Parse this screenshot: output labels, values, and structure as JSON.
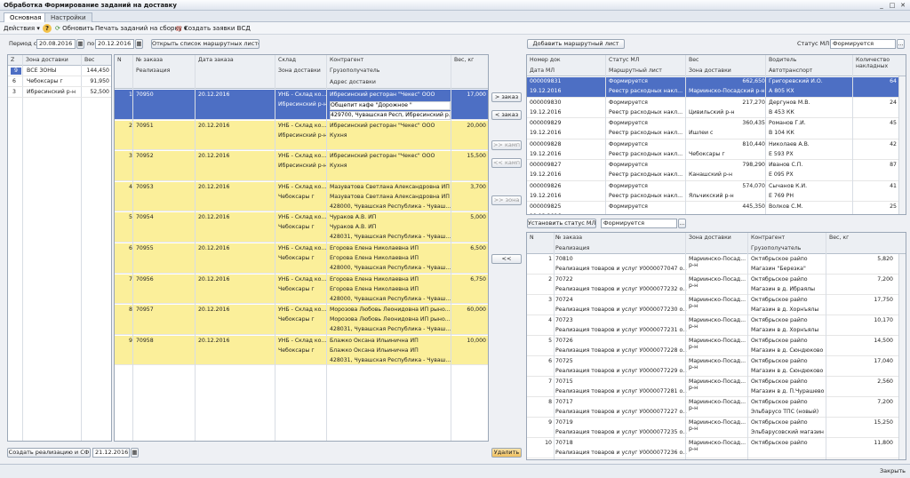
{
  "window": {
    "title": "Обработка  Формирование заданий на доставку",
    "min": "_",
    "max": "□",
    "close": "✕"
  },
  "tabs": [
    "Основная",
    "Настройки"
  ],
  "toolbar": {
    "actions": "Действия",
    "help": "?",
    "refresh": "Обновить",
    "print": "Печать заданий на сборку",
    "create_vsd": "Создать заявки ВСД"
  },
  "filters": {
    "period_label": "Период с",
    "date_from": "20.08.2016",
    "to_label": "по",
    "date_to": "20.12.2016",
    "open_list": "Открыть список маршрутных листов"
  },
  "zones": {
    "headers": [
      "Z",
      "Зона доставки",
      "Вес"
    ],
    "rows": [
      {
        "n": "9",
        "zone": "ВСЕ ЗОНЫ",
        "w": "144,450"
      },
      {
        "n": "6",
        "zone": "Чебоксары г",
        "w": "91,950"
      },
      {
        "n": "3",
        "zone": "Ибресинский р-н",
        "w": "52,500"
      }
    ]
  },
  "orders": {
    "headers": {
      "n": "N",
      "num": "№ заказа",
      "date": "Дата заказа",
      "wh": "Склад",
      "contr": "Контрагент",
      "w": "Вес, кг",
      "real": "Реализация",
      "zone": "Зона доставки",
      "cons": "Грузополучатель",
      "addr": "Адрес доставки"
    },
    "rows": [
      {
        "n": "1",
        "num": "70950",
        "date": "20.12.2016",
        "wh": "УНБ - Склад ко...",
        "zone": "Ибресинский р-н",
        "contr": "Ибресинский ресторан \"Чекес\" ООО",
        "cons": "Общепит кафе \"Дорожное \"",
        "addr": "429700, Чувашская Респ, Ибресинский р...",
        "w": "17,000"
      },
      {
        "n": "2",
        "num": "70951",
        "date": "20.12.2016",
        "wh": "УНБ - Склад ко...",
        "zone": "Ибресинский р-н",
        "contr": "Ибресинский ресторан \"Чекес\" ООО",
        "cons": "Кухня",
        "addr": "",
        "w": "20,000"
      },
      {
        "n": "3",
        "num": "70952",
        "date": "20.12.2016",
        "wh": "УНБ - Склад ко...",
        "zone": "Ибресинский р-н",
        "contr": "Ибресинский ресторан \"Чекес\" ООО",
        "cons": "Кухня",
        "addr": "",
        "w": "15,500"
      },
      {
        "n": "4",
        "num": "70953",
        "date": "20.12.2016",
        "wh": "УНБ - Склад ко...",
        "zone": "Чебоксары г",
        "contr": "Мазуватова Светлана Александровна ИП",
        "cons": "Мазуватова Светлана Александровна ИП",
        "addr": "428000, Чувашская Республика - Чуваш...",
        "w": "3,700"
      },
      {
        "n": "5",
        "num": "70954",
        "date": "20.12.2016",
        "wh": "УНБ - Склад ко...",
        "zone": "Чебоксары г",
        "contr": "Чураков А.В. ИП",
        "cons": "Чураков А.В. ИП",
        "addr": "428031, Чувашская Республика - Чуваш...",
        "w": "5,000"
      },
      {
        "n": "6",
        "num": "70955",
        "date": "20.12.2016",
        "wh": "УНБ - Склад ко...",
        "zone": "Чебоксары г",
        "contr": "Егорова Елена Николаевна ИП",
        "cons": "Егорова Елена Николаевна ИП",
        "addr": "428000, Чувашская Республика - Чуваш...",
        "w": "6,500"
      },
      {
        "n": "7",
        "num": "70956",
        "date": "20.12.2016",
        "wh": "УНБ - Склад ко...",
        "zone": "Чебоксары г",
        "contr": "Егорова Елена Николаевна ИП",
        "cons": "Егорова Елена Николаевна ИП",
        "addr": "428000, Чувашская Республика - Чуваш...",
        "w": "6,750"
      },
      {
        "n": "8",
        "num": "70957",
        "date": "20.12.2016",
        "wh": "УНБ - Склад ко...",
        "zone": "Чебоксары г",
        "contr": "Морозова Любовь Леонидовна ИП рыно...",
        "cons": "Морозова Любовь Леонидовна ИП рыно...",
        "addr": "428031, Чувашская Республика - Чуваш...",
        "w": "60,000"
      },
      {
        "n": "9",
        "num": "70958",
        "date": "20.12.2016",
        "wh": "УНБ - Склад ко...",
        "zone": "Чебоксары г",
        "contr": "Блажко Оксана Ильинична ИП",
        "cons": "Блажко Оксана Ильинична ИП",
        "addr": "428031, Чувашская Республика - Чуваш...",
        "w": "10,000"
      }
    ]
  },
  "middle": {
    "to_order": "> заказ",
    "from_order": "< заказ",
    "to_kamp": ">> камп",
    "from_kamp": "<< камп",
    "to_zone": ">> зона",
    "all_back": "<<"
  },
  "bottom_left": {
    "create_btn": "Создать реализацию и СФ",
    "date": "21.12.2016",
    "delete_btn": "Удалить"
  },
  "ml": {
    "add_btn": "Добавить маршрутный лист",
    "status_label": "Статус МЛ:",
    "status_value": "Формируется",
    "headers": {
      "doc": "Номер док",
      "status": "Статус МЛ",
      "w": "Вес",
      "driver": "Водитель",
      "cnt": "Количество накладных",
      "date": "Дата МЛ",
      "route": "Маршрутный лист",
      "zone": "Зона доставки",
      "car": "Автотранспорт"
    },
    "rows": [
      {
        "doc": "000009831",
        "status": "Формируется",
        "w": "662,650",
        "driver": "Григоревский И.О.",
        "cnt": "64",
        "date": "19.12.2016",
        "route": "Реестр расходных накл...",
        "zone": "Мариинско-Посадский р-н",
        "car": "А 805 КХ",
        "sel": true
      },
      {
        "doc": "000009830",
        "status": "Формируется",
        "w": "217,270",
        "driver": "Дергунов М.В.",
        "cnt": "24",
        "date": "19.12.2016",
        "route": "Реестр расходных накл...",
        "zone": "Цивильский р-н",
        "car": "В 453 КК"
      },
      {
        "doc": "000009829",
        "status": "Формируется",
        "w": "360,435",
        "driver": "Романов Г.И.",
        "cnt": "45",
        "date": "19.12.2016",
        "route": "Реестр расходных накл...",
        "zone": "Ишлеи с",
        "car": "В 104 КК"
      },
      {
        "doc": "000009828",
        "status": "Формируется",
        "w": "810,440",
        "driver": "Николаев А.В.",
        "cnt": "42",
        "date": "19.12.2016",
        "route": "Реестр расходных накл...",
        "zone": "Чебоксары г",
        "car": "Е 593 РХ"
      },
      {
        "doc": "000009827",
        "status": "Формируется",
        "w": "798,290",
        "driver": "Иванов С.П.",
        "cnt": "87",
        "date": "19.12.2016",
        "route": "Реестр расходных накл...",
        "zone": "Канашский р-н",
        "car": "Е 095 РХ"
      },
      {
        "doc": "000009826",
        "status": "Формируется",
        "w": "574,070",
        "driver": "Сычанов К.И.",
        "cnt": "41",
        "date": "19.12.2016",
        "route": "Реестр расходных накл...",
        "zone": "Яльчикский р-н",
        "car": "Е 769 РН"
      },
      {
        "doc": "000009825",
        "status": "Формируется",
        "w": "445,350",
        "driver": "Волков С.М.",
        "cnt": "25",
        "date": "19.12.2016",
        "route": "",
        "zone": "",
        "car": ""
      }
    ]
  },
  "set_status": {
    "btn": "Установить статус МЛ",
    "value": "Формируется"
  },
  "details": {
    "headers": {
      "n": "N",
      "num": "№ заказа",
      "zone": "Зона доставки",
      "contr": "Контрагент",
      "w": "Вес, кг",
      "real": "Реализация",
      "cons": "Грузополучатель"
    },
    "rows": [
      {
        "n": "1",
        "num": "70810",
        "real": "Реализация товаров и услуг У0000077047 о...",
        "zone": "Мариинско-Посад... р-н",
        "contr": "Октябрьское райпо",
        "cons": "Магазин \"Березка\"",
        "w": "5,820"
      },
      {
        "n": "2",
        "num": "70722",
        "real": "Реализация товаров и услуг У0000077232 о...",
        "zone": "Мариинско-Посад... р-н",
        "contr": "Октябрьское райпо",
        "cons": "Магазин в д. Ибраялы",
        "w": "7,200"
      },
      {
        "n": "3",
        "num": "70724",
        "real": "Реализация товаров и услуг У0000077230 о...",
        "zone": "Мариинско-Посад... р-н",
        "contr": "Октябрьское райпо",
        "cons": "Магазин в д. Хорнъялы",
        "w": "17,750"
      },
      {
        "n": "4",
        "num": "70723",
        "real": "Реализация товаров и услуг У0000077231 о...",
        "zone": "Мариинско-Посад... р-н",
        "contr": "Октябрьское райпо",
        "cons": "Магазин в д. Хорнъялы",
        "w": "10,170"
      },
      {
        "n": "5",
        "num": "70726",
        "real": "Реализация товаров и услуг У0000077228 о...",
        "zone": "Мариинско-Посад... р-н",
        "contr": "Октябрьское райпо",
        "cons": "Магазин в д. Сюндюково",
        "w": "14,500"
      },
      {
        "n": "6",
        "num": "70725",
        "real": "Реализация товаров и услуг У0000077229 о...",
        "zone": "Мариинско-Посад... р-н",
        "contr": "Октябрьское райпо",
        "cons": "Магазин в д. Сюндюково",
        "w": "17,040"
      },
      {
        "n": "7",
        "num": "70715",
        "real": "Реализация товаров и услуг У0000077281 о...",
        "zone": "Мариинско-Посад... р-н",
        "contr": "Октябрьское райпо",
        "cons": "Магазин в д. П.Чурашево",
        "w": "2,560"
      },
      {
        "n": "8",
        "num": "70717",
        "real": "Реализация товаров и услуг У0000077227 о...",
        "zone": "Мариинско-Посад... р-н",
        "contr": "Октябрьское райпо",
        "cons": "Эльбарусо ТПС (новый)",
        "w": "7,200"
      },
      {
        "n": "9",
        "num": "70719",
        "real": "Реализация товаров и услуг У0000077235 о...",
        "zone": "Мариинско-Посад... р-н",
        "contr": "Октябрьское райпо",
        "cons": "Эльбарусовский магазин",
        "w": "15,250"
      },
      {
        "n": "10",
        "num": "70718",
        "real": "Реализация товаров и услуг У0000077236 о...",
        "zone": "Мариинско-Посад... р-н",
        "contr": "Октябрьское райпо",
        "cons": "",
        "w": "11,800"
      }
    ]
  },
  "status": {
    "close": "Закрыть"
  },
  "colors": {
    "selection": "#4d6fc4",
    "highlight": "#fbef9a",
    "accent": "#f0c060"
  }
}
